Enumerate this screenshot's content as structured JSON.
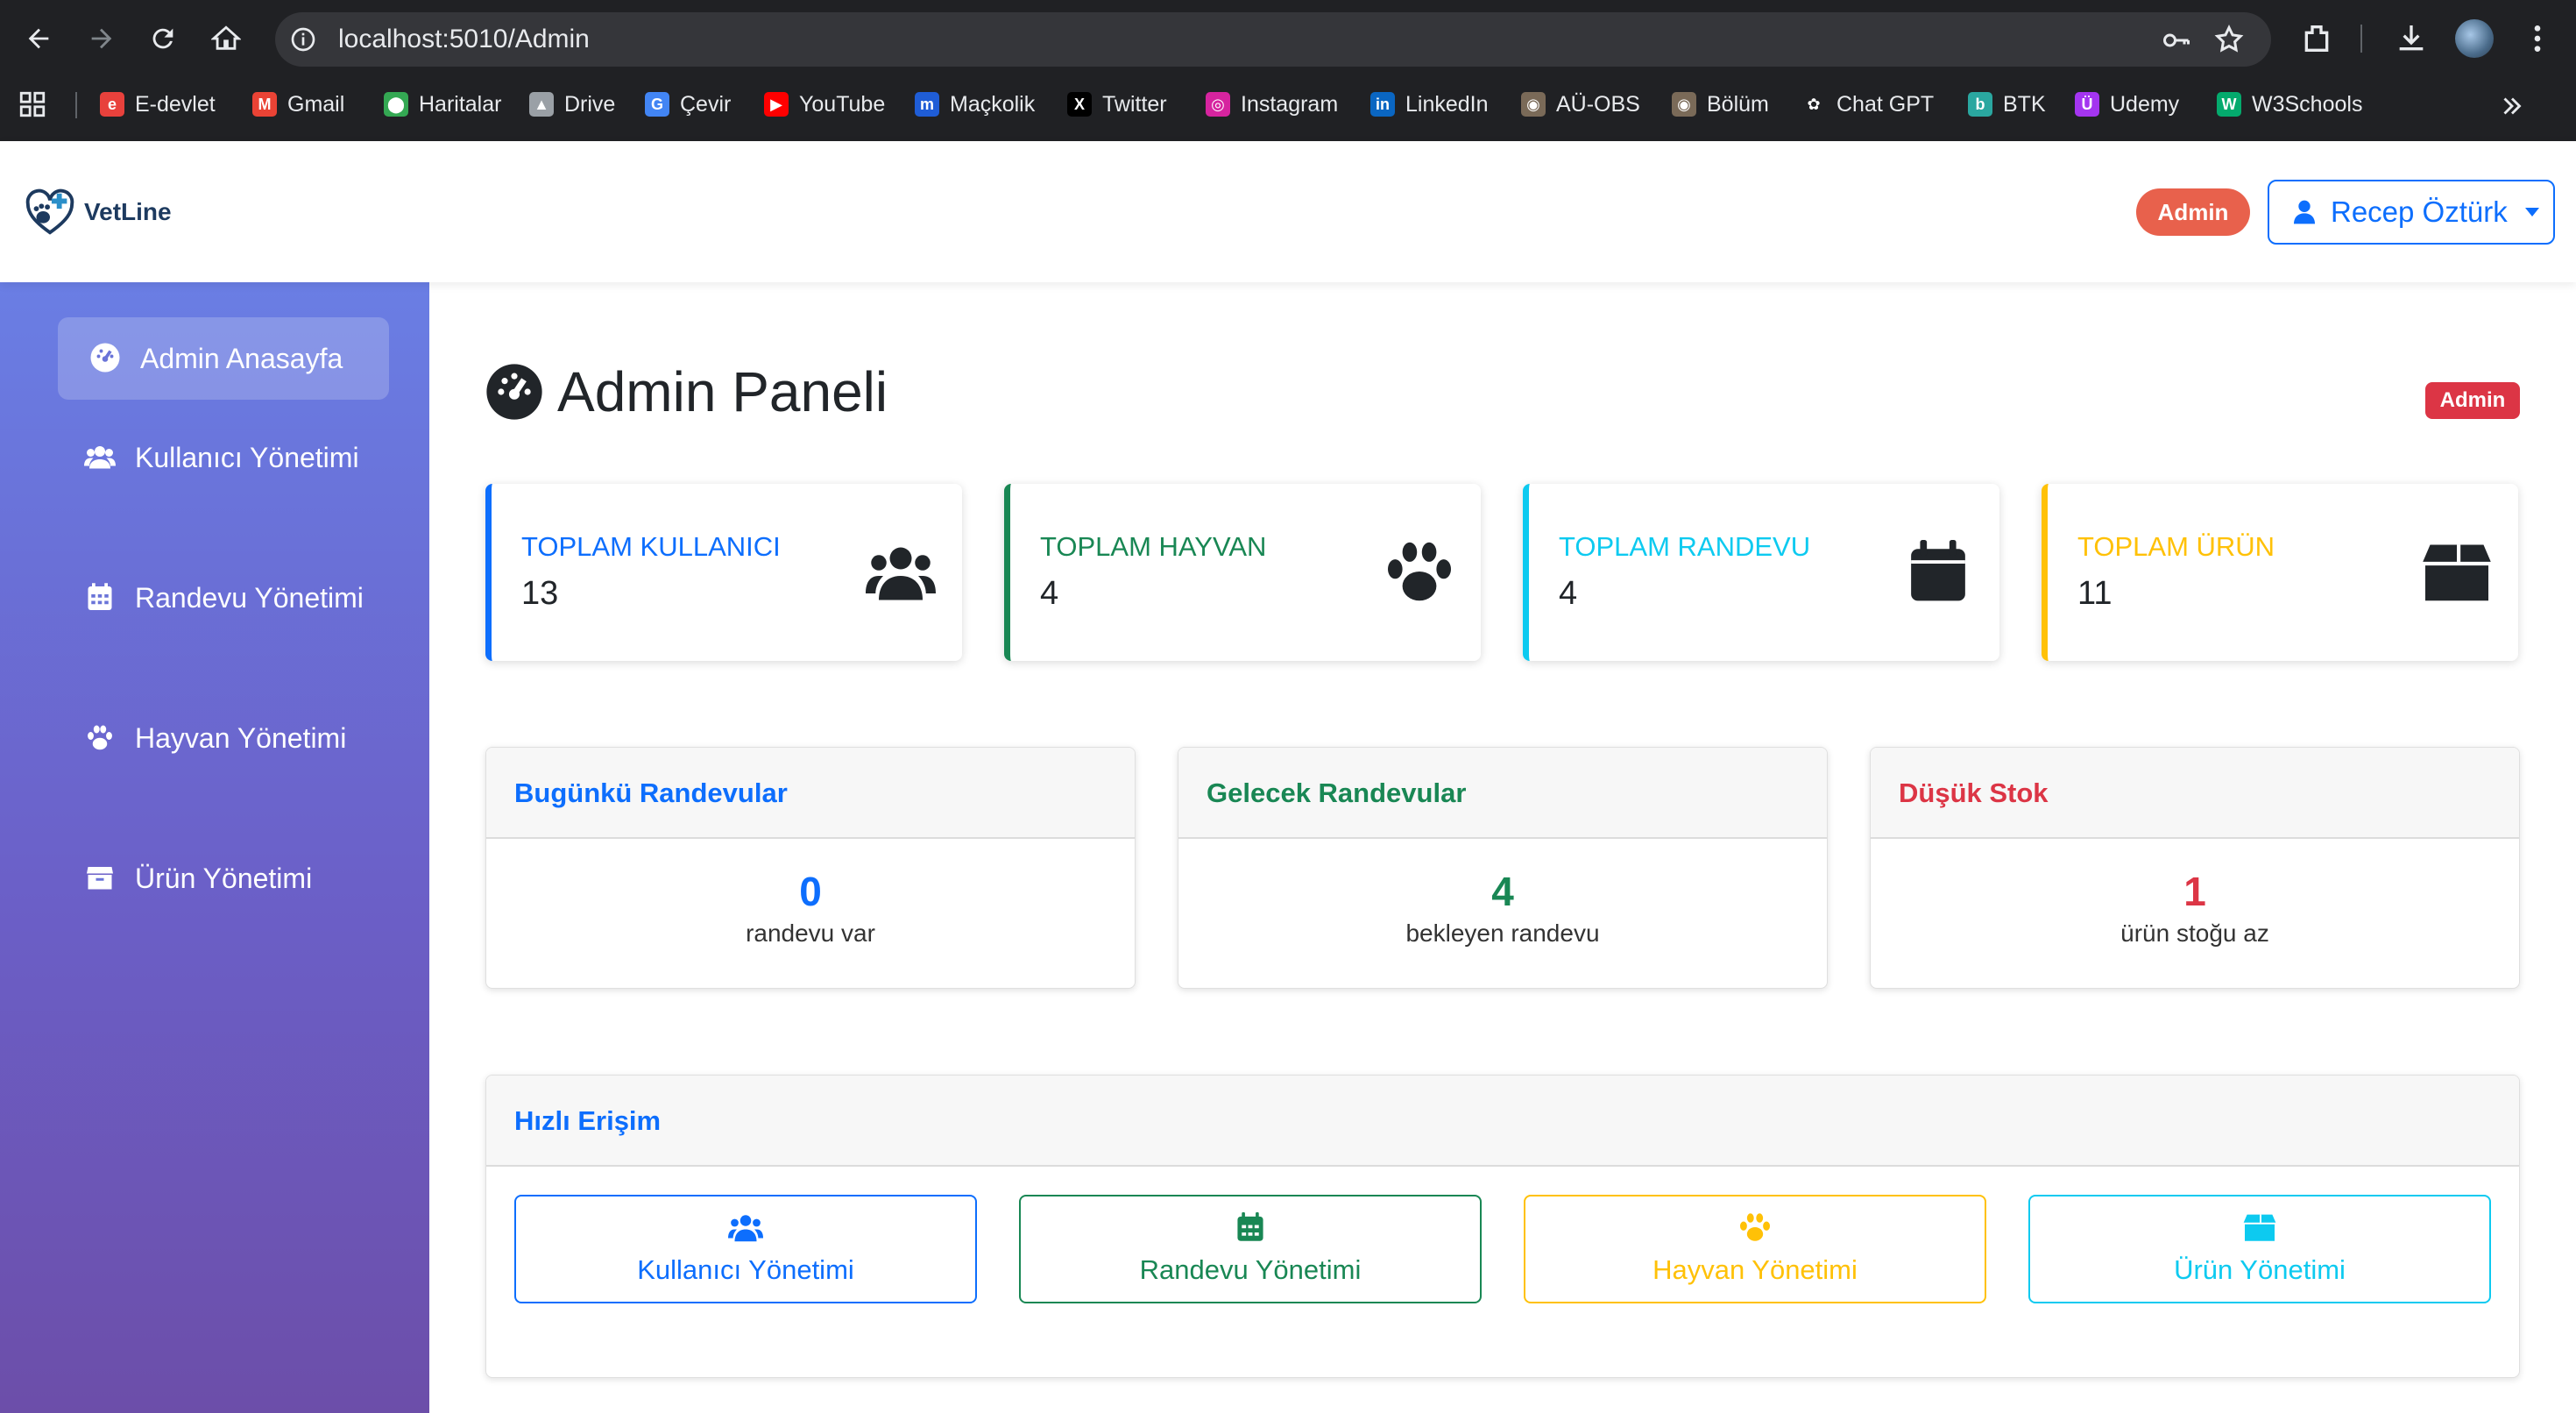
{
  "browser": {
    "url": "localhost:5010/Admin",
    "bookmarks": [
      {
        "label": "E-devlet",
        "icon": "edevlet-icon",
        "color": "#e8413c"
      },
      {
        "label": "Gmail",
        "icon": "gmail-icon",
        "color": "#ea4335"
      },
      {
        "label": "Haritalar",
        "icon": "maps-icon",
        "color": "#34a853"
      },
      {
        "label": "Drive",
        "icon": "drive-icon",
        "color": "#9aa0a6"
      },
      {
        "label": "Çevir",
        "icon": "translate-icon",
        "color": "#4285f4"
      },
      {
        "label": "YouTube",
        "icon": "youtube-icon",
        "color": "#ff0000"
      },
      {
        "label": "Maçkolik",
        "icon": "mackolik-icon",
        "color": "#1f5dd6"
      },
      {
        "label": "Twitter",
        "icon": "x-icon",
        "color": "#000000"
      },
      {
        "label": "Instagram",
        "icon": "instagram-icon",
        "color": "#d6249f"
      },
      {
        "label": "LinkedIn",
        "icon": "linkedin-icon",
        "color": "#0a66c2"
      },
      {
        "label": "AÜ-OBS",
        "icon": "university-seal-icon",
        "color": "#7a6a58"
      },
      {
        "label": "Bölüm",
        "icon": "university-seal-icon",
        "color": "#7a6a58"
      },
      {
        "label": "Chat GPT",
        "icon": "chatgpt-icon",
        "color": "#202124"
      },
      {
        "label": "BTK",
        "icon": "btk-icon",
        "color": "#2aa7a0"
      },
      {
        "label": "Udemy",
        "icon": "udemy-icon",
        "color": "#a435f0"
      },
      {
        "label": "W3Schools",
        "icon": "w3schools-icon",
        "color": "#04aa6d"
      }
    ]
  },
  "app": {
    "brand": "VetLine",
    "role_badge": "Admin",
    "user_name": "Recep Öztürk"
  },
  "sidebar": {
    "items": [
      {
        "label": "Admin Anasayfa",
        "icon": "dashboard-icon",
        "active": true
      },
      {
        "label": "Kullanıcı Yönetimi",
        "icon": "users-icon",
        "active": false
      },
      {
        "label": "Randevu Yönetimi",
        "icon": "calendar-icon",
        "active": false
      },
      {
        "label": "Hayvan Yönetimi",
        "icon": "paw-icon",
        "active": false
      },
      {
        "label": "Ürün Yönetimi",
        "icon": "box-icon",
        "active": false
      }
    ]
  },
  "main": {
    "title": "Admin Paneli",
    "title_badge": "Admin",
    "stats": [
      {
        "label": "TOPLAM KULLANICI",
        "value": "13",
        "color": "#0d6efd",
        "icon": "users-icon"
      },
      {
        "label": "TOPLAM HAYVAN",
        "value": "4",
        "color": "#198754",
        "icon": "paw-icon"
      },
      {
        "label": "TOPLAM RANDEVU",
        "value": "4",
        "color": "#0dcaf0",
        "icon": "calendar-icon"
      },
      {
        "label": "TOPLAM ÜRÜN",
        "value": "11",
        "color": "#ffc107",
        "icon": "box-icon"
      }
    ],
    "panels": [
      {
        "title": "Bugünkü Randevular",
        "number": "0",
        "subtitle": "randevu var",
        "color": "#0d6efd"
      },
      {
        "title": "Gelecek Randevular",
        "number": "4",
        "subtitle": "bekleyen randevu",
        "color": "#198754"
      },
      {
        "title": "Düşük Stok",
        "number": "1",
        "subtitle": "ürün stoğu az",
        "color": "#dc3545"
      }
    ],
    "quick_access": {
      "title": "Hızlı Erişim",
      "buttons": [
        {
          "label": "Kullanıcı Yönetimi",
          "icon": "users-icon",
          "color": "#0d6efd"
        },
        {
          "label": "Randevu Yönetimi",
          "icon": "calendar-icon",
          "color": "#198754"
        },
        {
          "label": "Hayvan Yönetimi",
          "icon": "paw-icon",
          "color": "#ffc107"
        },
        {
          "label": "Ürün Yönetimi",
          "icon": "box-icon",
          "color": "#0dcaf0"
        }
      ]
    }
  }
}
